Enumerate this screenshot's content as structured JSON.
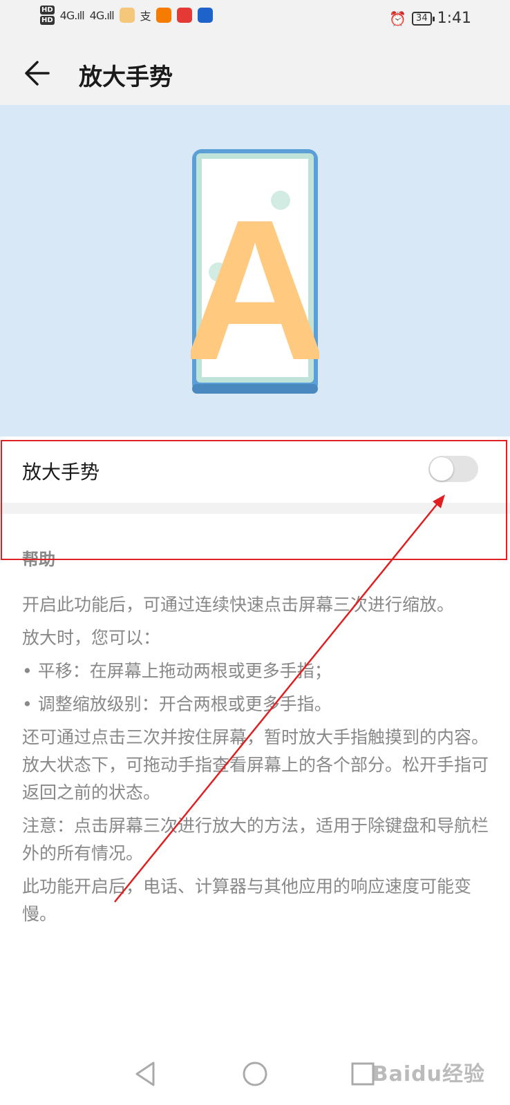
{
  "status_bar": {
    "hd1": "HD",
    "hd2": "HD",
    "signal1": "4G",
    "signal2": "4G",
    "battery": "34",
    "time": "1:41"
  },
  "header": {
    "title": "放大手势"
  },
  "banner": {
    "letter": "A"
  },
  "setting": {
    "label": "放大手势",
    "enabled": false
  },
  "help": {
    "heading": "帮助",
    "paragraphs": [
      "开启此功能后，可通过连续快速点击屏幕三次进行缩放。",
      "放大时，您可以：",
      "• 平移：在屏幕上拖动两根或更多手指；",
      "• 调整缩放级别：开合两根或更多手指。",
      "还可通过点击三次并按住屏幕，暂时放大手指触摸到的内容。放大状态下，可拖动手指查看屏幕上的各个部分。松开手指可返回之前的状态。",
      "注意：点击屏幕三次进行放大的方法，适用于除键盘和导航栏外的所有情况。",
      "此功能开启后，电话、计算器与其他应用的响应速度可能变慢。"
    ]
  },
  "watermark": "Baidu经验",
  "colors": {
    "banner_bg": "#d8e8f6",
    "phone_frame": "#5b9fd6",
    "letter": "#ffc97f",
    "annotation": "#e02020"
  }
}
